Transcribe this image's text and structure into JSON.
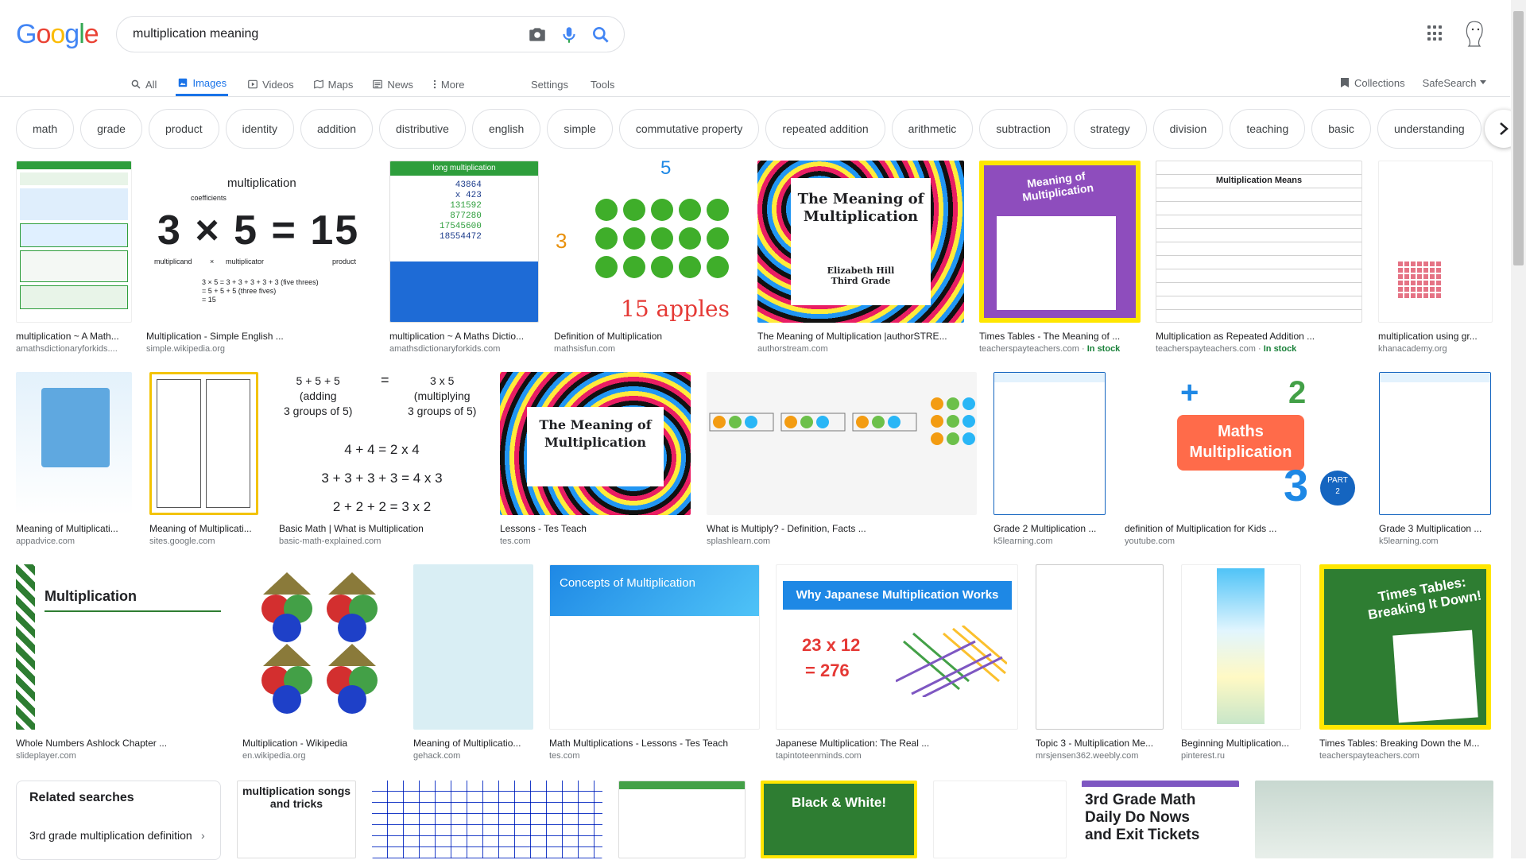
{
  "search": {
    "query": "multiplication meaning"
  },
  "tabs": [
    {
      "label": "All",
      "icon": "search-icon"
    },
    {
      "label": "Images",
      "icon": "image-icon"
    },
    {
      "label": "Videos",
      "icon": "video-icon"
    },
    {
      "label": "Maps",
      "icon": "map-icon"
    },
    {
      "label": "News",
      "icon": "news-icon"
    },
    {
      "label": "More",
      "icon": "more-vert-icon"
    }
  ],
  "tools": {
    "settings": "Settings",
    "tools": "Tools"
  },
  "right_tools": {
    "collections": "Collections",
    "safesearch": "SafeSearch"
  },
  "chips": [
    "math",
    "grade",
    "product",
    "identity",
    "addition",
    "distributive",
    "english",
    "simple",
    "commutative property",
    "repeated addition",
    "arithmetic",
    "subtraction",
    "strategy",
    "division",
    "teaching",
    "basic",
    "understanding"
  ],
  "results": [
    {
      "title": "multiplication ~ A Math...",
      "source": "amathsdictionaryforkids....",
      "stock": ""
    },
    {
      "title": "Multiplication - Simple English ...",
      "source": "simple.wikipedia.org",
      "stock": ""
    },
    {
      "title": "multiplication ~ A Maths Dictio...",
      "source": "amathsdictionaryforkids.com",
      "stock": ""
    },
    {
      "title": "Definition of Multiplication",
      "source": "mathsisfun.com",
      "stock": ""
    },
    {
      "title": "The Meaning of Multiplication |authorSTRE...",
      "source": "authorstream.com",
      "stock": ""
    },
    {
      "title": "Times Tables - The Meaning of ...",
      "source": "teacherspayteachers.com",
      "stock": "In stock"
    },
    {
      "title": "Multiplication as Repeated Addition ...",
      "source": "teacherspayteachers.com",
      "stock": "In stock"
    },
    {
      "title": "multiplication using gr...",
      "source": "khanacademy.org",
      "stock": ""
    },
    {
      "title": "Meaning of Multiplicati...",
      "source": "appadvice.com",
      "stock": ""
    },
    {
      "title": "Meaning of Multiplicati...",
      "source": "sites.google.com",
      "stock": ""
    },
    {
      "title": "Basic Math | What is Multiplication",
      "source": "basic-math-explained.com",
      "stock": ""
    },
    {
      "title": "Lessons - Tes Teach",
      "source": "tes.com",
      "stock": ""
    },
    {
      "title": "What is Multiply? - Definition, Facts ...",
      "source": "splashlearn.com",
      "stock": ""
    },
    {
      "title": "Grade 2 Multiplication ...",
      "source": "k5learning.com",
      "stock": ""
    },
    {
      "title": "definition of Multiplication for Kids ...",
      "source": "youtube.com",
      "stock": ""
    },
    {
      "title": "Grade 3 Multiplication ...",
      "source": "k5learning.com",
      "stock": ""
    },
    {
      "title": "Whole Numbers Ashlock Chapter ...",
      "source": "slideplayer.com",
      "stock": ""
    },
    {
      "title": "Multiplication - Wikipedia",
      "source": "en.wikipedia.org",
      "stock": ""
    },
    {
      "title": "Meaning of Multiplicatio...",
      "source": "gehack.com",
      "stock": ""
    },
    {
      "title": "Math Multiplications - Lessons - Tes Teach",
      "source": "tes.com",
      "stock": ""
    },
    {
      "title": "Japanese Multiplication: The Real ...",
      "source": "tapintoteenminds.com",
      "stock": ""
    },
    {
      "title": "Topic 3 - Multiplication Me...",
      "source": "mrsjensen362.weebly.com",
      "stock": ""
    },
    {
      "title": "Beginning Multiplication...",
      "source": "pinterest.ru",
      "stock": ""
    },
    {
      "title": "Times Tables: Breaking Down the M...",
      "source": "teacherspayteachers.com",
      "stock": ""
    }
  ],
  "image_text": {
    "multiplication": "multiplication",
    "coefficients": "coefficients",
    "equation": "3 × 5 = 15",
    "multiplicand": "multiplicand",
    "times": "×",
    "multiplicator": "multiplicator",
    "product": "product",
    "steps": "3 × 5 = 3 + 3 + 3 + 3 + 3 (five threes)\n= 5 + 5 + 5 (three fives)\n= 15",
    "long_mult": "long multiplication",
    "long_a": "43864",
    "long_b": "x 423",
    "long_c": "131592",
    "long_d": "877280",
    "long_e": "17545600",
    "long_f": "18554472",
    "five": "5",
    "three": "3",
    "apples": "15 apples",
    "meaning_title": "The Meaning of Multiplication",
    "elizabeth": "Elizabeth Hill\nThird Grade",
    "tt_meaning": "Meaning of Multiplication",
    "mult_means": "Multiplication Means",
    "basic_left": "5 + 5 + 5\n(adding\n3 groups of 5)",
    "basic_eq": "=",
    "basic_right": "3 x 5\n(multiplying\n3 groups of 5)",
    "basic_l1": "4 + 4 = 2 x 4",
    "basic_l2": "3 + 3 + 3 + 3 = 4 x 3",
    "basic_l3": "2 + 2 + 2 = 3 x 2",
    "maths_mult": "Maths\nMultiplication",
    "part": "PART\n2",
    "slide_title": "Multiplication",
    "concepts": "Concepts of Multiplication",
    "japanese": "Why Japanese Multiplication Works",
    "jp_a": "23 x 12",
    "jp_b": "= 276",
    "times_tables": "Times Tables:\nBreaking It Down!",
    "mult_songs": "multiplication songs and tricks",
    "black_white": "Black & White!",
    "daily": "3rd Grade Math\nDaily Do Nows\nand Exit Tickets"
  },
  "related": {
    "title": "Related searches",
    "item": "3rd grade multiplication definition"
  }
}
